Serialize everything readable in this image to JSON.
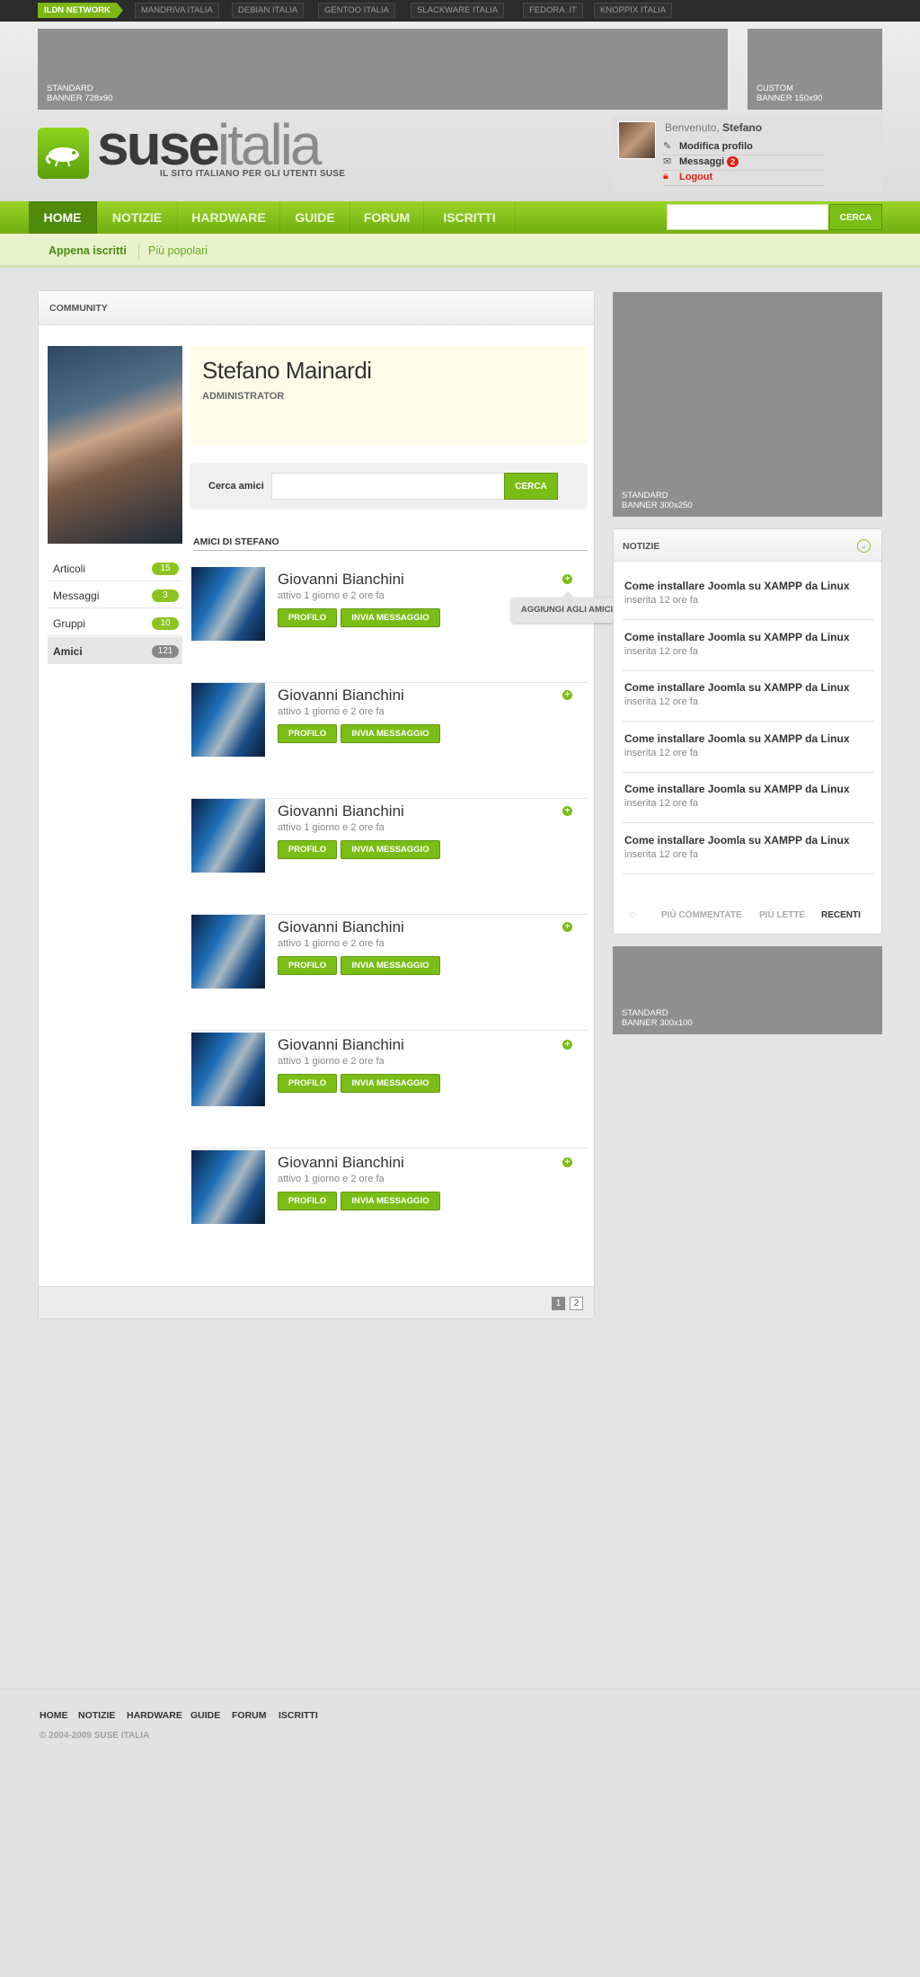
{
  "network": {
    "badge": "ILDN NETWORK",
    "links": [
      "MANDRIVA ITALIA",
      "DEBIAN ITALIA",
      "GENTOO ITALIA",
      "SLACKWARE ITALIA",
      "FEDORA .IT",
      "KNOPPIX ITALIA"
    ]
  },
  "banners": {
    "top_left": [
      "STANDARD",
      "BANNER 728x90"
    ],
    "top_right": [
      "CUSTOM",
      "BANNER 150x90"
    ],
    "side_big": [
      "STANDARD",
      "BANNER 300x250"
    ],
    "side_small": [
      "STANDARD",
      "BANNER 300x100"
    ]
  },
  "logo": {
    "part1": "suse",
    "part2": "italia",
    "tagline": "IL SITO ITALIANO PER GLI UTENTI SUSE"
  },
  "user": {
    "welcome_prefix": "Benvenuto, ",
    "username": "Stefano",
    "edit_profile": "Modifica profilo",
    "messages": "Messaggi",
    "messages_count": "2",
    "logout": "Logout"
  },
  "nav": {
    "items": [
      "HOME",
      "NOTIZIE",
      "HARDWARE",
      "GUIDE",
      "FORUM",
      "ISCRITTI"
    ],
    "active": "HOME",
    "search_button": "CERCA"
  },
  "subnav": {
    "items": [
      "Appena iscritti",
      "Più popolari"
    ]
  },
  "community": {
    "title": "COMMUNITY",
    "profile": {
      "name": "Stefano Mainardi",
      "role": "ADMINISTRATOR"
    },
    "stats": [
      {
        "label": "Articoli",
        "count": "15"
      },
      {
        "label": "Messaggi",
        "count": "3"
      },
      {
        "label": "Gruppi",
        "count": "10"
      },
      {
        "label": "Amici",
        "count": "121"
      }
    ],
    "search_label": "Cerca amici",
    "search_button": "CERCA",
    "friends_title": "AMICI DI STEFANO",
    "friends": [
      {
        "name": "Giovanni Bianchini",
        "status": "attivo 1 giorno e 2 ore fa"
      },
      {
        "name": "Giovanni Bianchini",
        "status": "attivo 1 giorno e 2 ore fa"
      },
      {
        "name": "Giovanni Bianchini",
        "status": "attivo 1 giorno e 2 ore fa"
      },
      {
        "name": "Giovanni Bianchini",
        "status": "attivo 1 giorno e 2 ore fa"
      },
      {
        "name": "Giovanni Bianchini",
        "status": "attivo 1 giorno e 2 ore fa"
      },
      {
        "name": "Giovanni Bianchini",
        "status": "attivo 1 giorno e 2 ore fa"
      }
    ],
    "profile_button": "PROFILO",
    "message_button": "INVIA MESSAGGIO",
    "add_friend_tooltip": "AGGIUNGI AGLI AMICI",
    "pages": [
      "1",
      "2"
    ]
  },
  "news": {
    "title": "NOTIZIE",
    "items": [
      {
        "title": "Come installare Joomla su XAMPP da Linux",
        "date": "inserita 12 ore fa"
      },
      {
        "title": "Come installare Joomla su XAMPP da Linux",
        "date": "inserita 12 ore fa"
      },
      {
        "title": "Come installare Joomla su XAMPP da Linux",
        "date": "inserita 12 ore fa"
      },
      {
        "title": "Come installare Joomla su XAMPP da Linux",
        "date": "inserita 12 ore fa"
      },
      {
        "title": "Come installare Joomla su XAMPP da Linux",
        "date": "inserita 12 ore fa"
      },
      {
        "title": "Come installare Joomla su XAMPP da Linux",
        "date": "inserita 12 ore fa"
      }
    ],
    "tabs": [
      "PIÙ COMMENTATE",
      "PIÙ LETTE",
      "RECENTI"
    ],
    "active_tab": "RECENTI"
  },
  "footer": {
    "links": [
      "HOME",
      "NOTIZIE",
      "HARDWARE",
      "GUIDE",
      "FORUM",
      "ISCRITTI"
    ],
    "copyright": "© 2004-2009 SUSE  ITALIA"
  },
  "colors": {
    "accent": "#7bbd17",
    "accent_dark": "#4f8a0a",
    "background": "#e3e4e3"
  }
}
